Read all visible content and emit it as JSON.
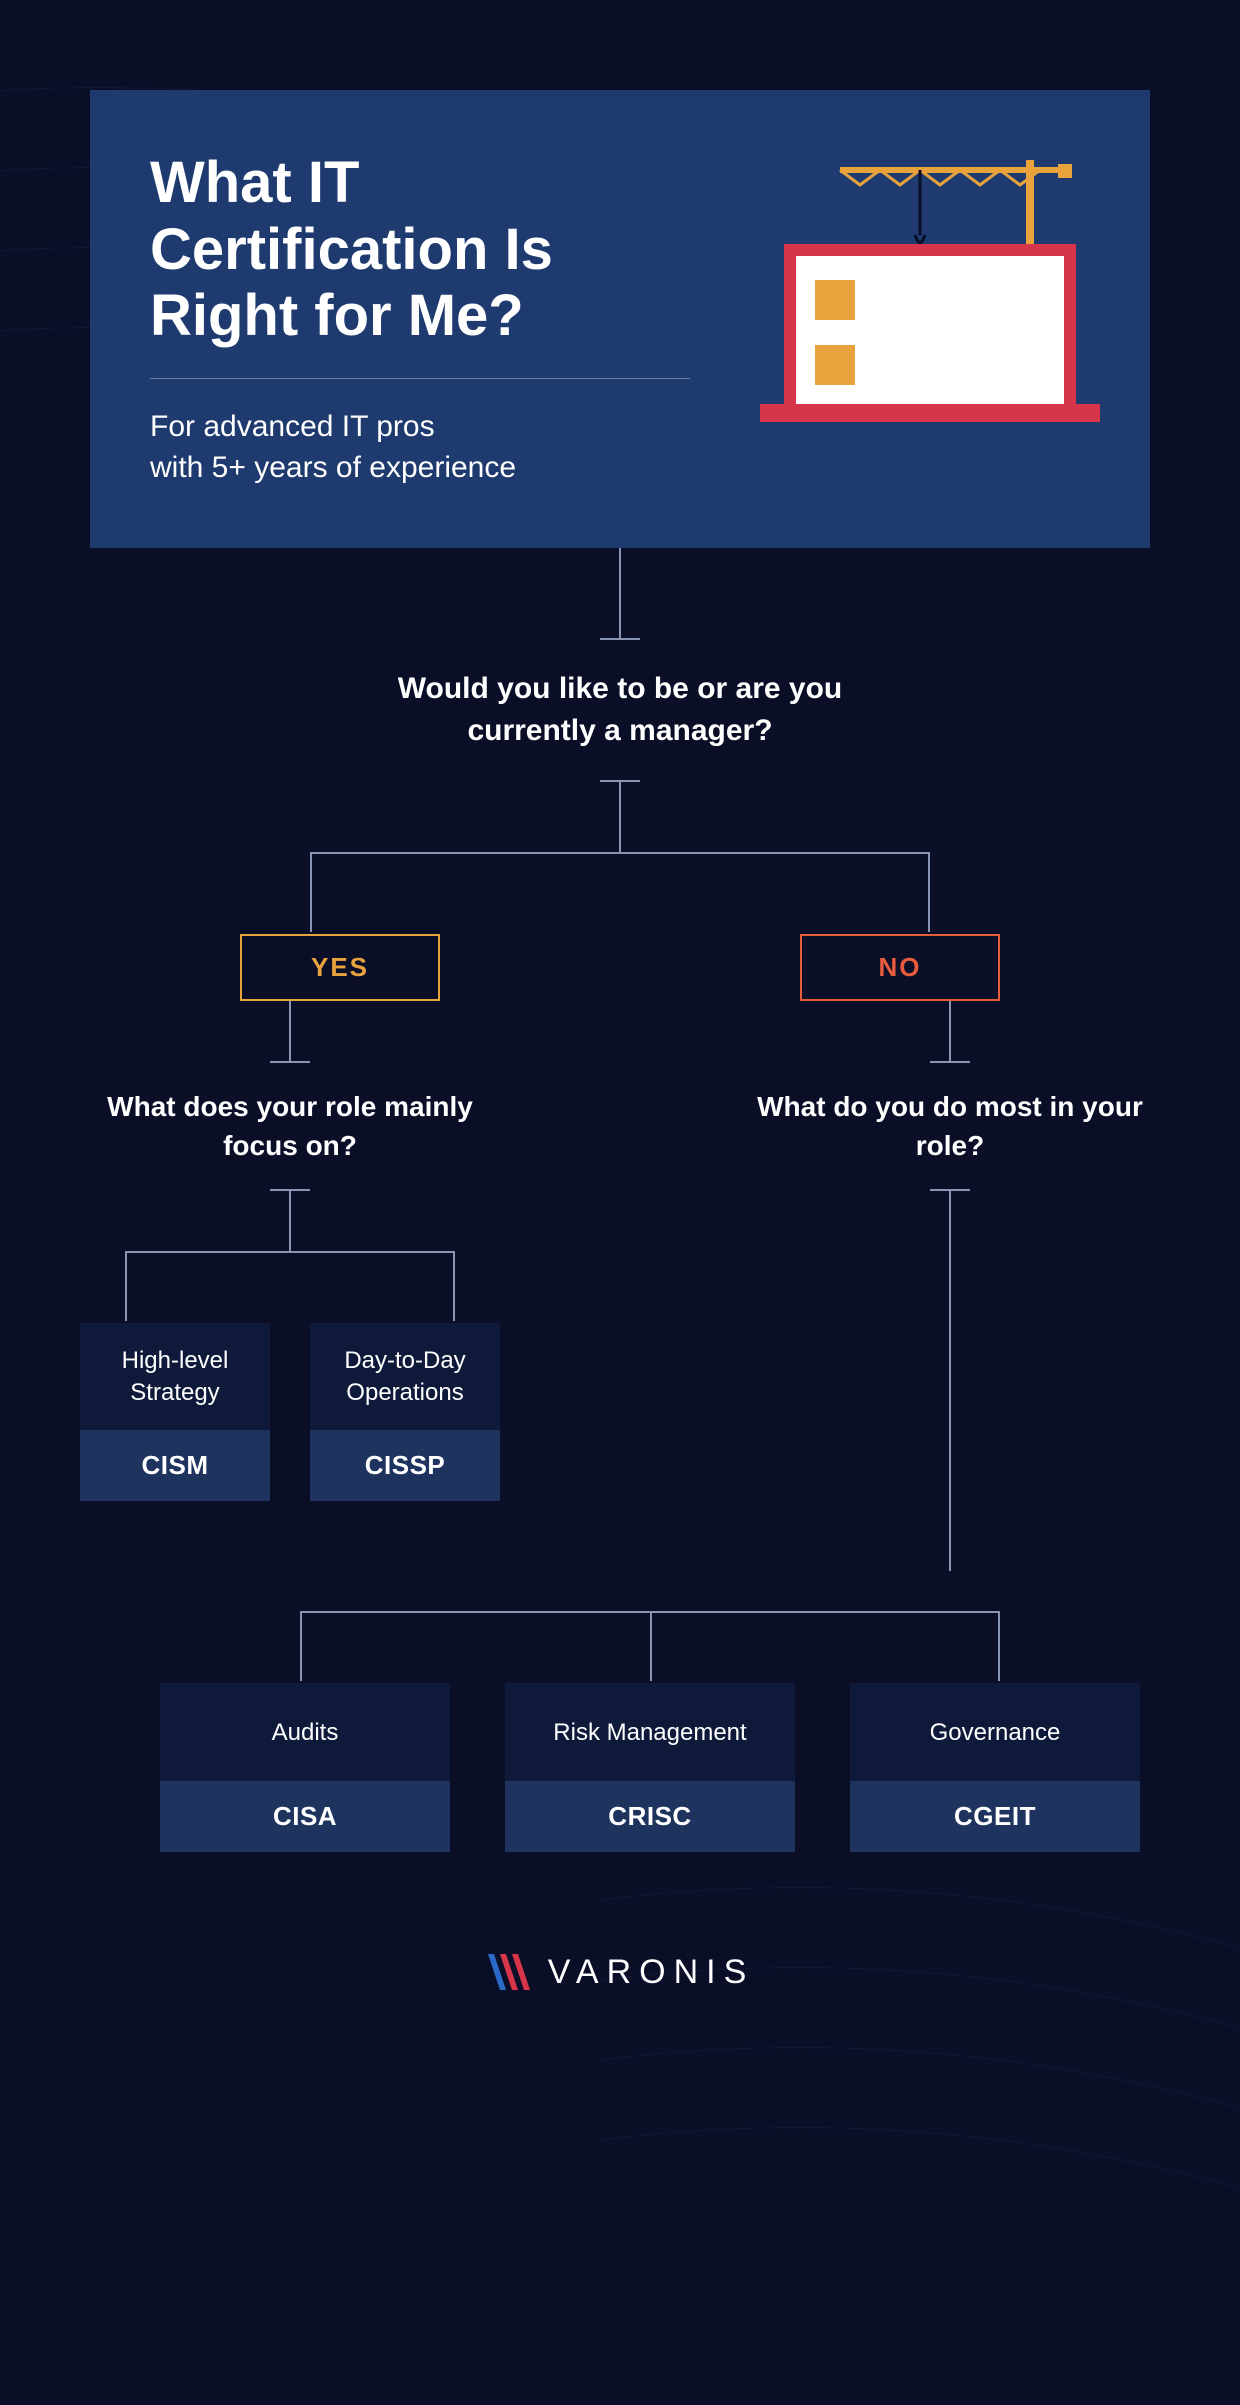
{
  "header": {
    "title": "What IT Certification Is Right for Me?",
    "subtitle_line1": "For advanced IT pros",
    "subtitle_line2": "with 5+ years of experience"
  },
  "q1": "Would you like to be or are you currently a manager?",
  "answers": {
    "yes": "YES",
    "no": "NO"
  },
  "q_yes": "What does your role mainly focus on?",
  "q_no": "What do you do most in your role?",
  "yes_results": [
    {
      "label": "High-level Strategy",
      "cert": "CISM"
    },
    {
      "label": "Day-to-Day Operations",
      "cert": "CISSP"
    }
  ],
  "no_results": [
    {
      "label": "Audits",
      "cert": "CISA"
    },
    {
      "label": "Risk Management",
      "cert": "CRISC"
    },
    {
      "label": "Governance",
      "cert": "CGEIT"
    }
  ],
  "brand": "VARONIS",
  "colors": {
    "bg": "#0a0e27",
    "card": "#1e3a6e",
    "yes": "#e8a33c",
    "no": "#e85c3c",
    "line": "#8a94b5"
  }
}
